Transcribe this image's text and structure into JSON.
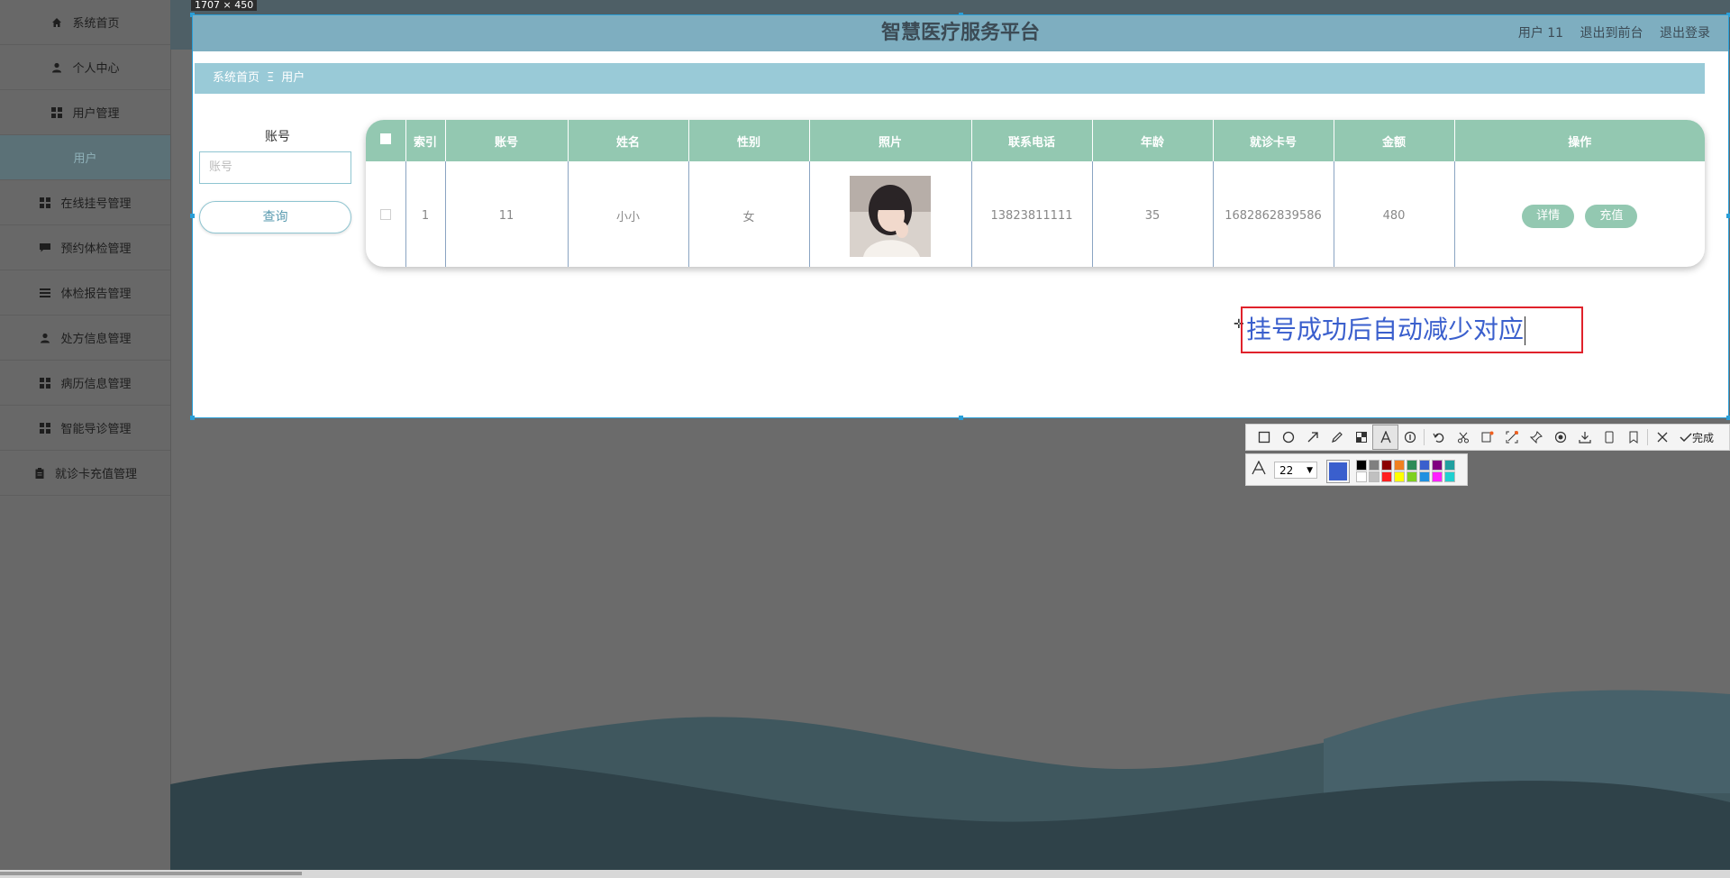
{
  "sidebar": {
    "items": [
      {
        "label": "系统首页",
        "icon": "home-icon"
      },
      {
        "label": "个人中心",
        "icon": "person-icon"
      },
      {
        "label": "用户管理",
        "icon": "grid-icon"
      },
      {
        "label": "用户",
        "icon": ""
      },
      {
        "label": "在线挂号管理",
        "icon": "grid-icon"
      },
      {
        "label": "预约体检管理",
        "icon": "chat-icon"
      },
      {
        "label": "体检报告管理",
        "icon": "list-icon"
      },
      {
        "label": "处方信息管理",
        "icon": "person-icon"
      },
      {
        "label": "病历信息管理",
        "icon": "grid-icon"
      },
      {
        "label": "智能导诊管理",
        "icon": "grid-icon"
      },
      {
        "label": "就诊卡充值管理",
        "icon": "clipboard-icon"
      }
    ]
  },
  "capture": {
    "size_label": "1707 × 450"
  },
  "header": {
    "title": "智慧医疗服务平台",
    "user": "用户 11",
    "to_front": "退出到前台",
    "logout": "退出登录"
  },
  "breadcrumb": {
    "home": "系统首页",
    "separator": "Ξ",
    "current": "用户"
  },
  "search": {
    "label": "账号",
    "placeholder": "账号",
    "button": "查询"
  },
  "table": {
    "columns": [
      "索引",
      "账号",
      "姓名",
      "性别",
      "照片",
      "联系电话",
      "年龄",
      "就诊卡号",
      "金额",
      "操作"
    ],
    "rows": [
      {
        "index": "1",
        "account": "11",
        "name": "小小",
        "gender": "女",
        "phone": "13823811111",
        "age": "35",
        "card_no": "1682862839586",
        "amount": "480",
        "actions": [
          "详情",
          "充值"
        ]
      }
    ]
  },
  "annotation": {
    "text": "挂号成功后自动减少对应"
  },
  "toolbar": {
    "tools": [
      "rectangle-icon",
      "ellipse-icon",
      "arrow-icon",
      "pencil-icon",
      "mosaic-icon",
      "text-icon",
      "number-icon",
      "undo-icon",
      "cut-icon",
      "ocr-icon",
      "scan-icon",
      "pin-icon",
      "record-icon",
      "save-icon",
      "device-icon",
      "bookmark-icon",
      "close-icon"
    ],
    "selected": "text-icon",
    "done_label": "完成",
    "font_size": "22",
    "current_color": "#3a5fcd",
    "palette": [
      "#000000",
      "#808080",
      "#8b0000",
      "#f08020",
      "#2e8b57",
      "#3a5fcd",
      "#800080",
      "#20a0a0",
      "#ffffff",
      "#c0c0c0",
      "#ff2020",
      "#ffff00",
      "#7fd020",
      "#2090e0",
      "#ff20ff",
      "#20d0d0"
    ]
  },
  "colors": {
    "header": "#7eaec0",
    "breadcrumb": "#99cad7",
    "table_header": "#93c8b1",
    "annotation_border": "#e0222b"
  }
}
